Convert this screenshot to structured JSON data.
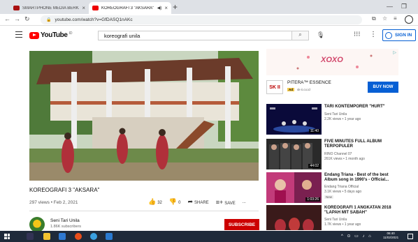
{
  "browser": {
    "tabs": [
      {
        "title": "SMARTPHONE MEDIA BERKARYA",
        "active": false,
        "favicon": "photo-favicon"
      },
      {
        "title": "KOREOGRAFI 3 \"AKSARA\"",
        "active": true,
        "favicon": "youtube-favicon"
      }
    ],
    "url": "youtube.com/watch?v=GfDASQ1nAKc"
  },
  "youtube": {
    "logo_text": "YouTube",
    "logo_country": "ID",
    "search_query": "koreografi unila",
    "signin_label": "SIGN IN"
  },
  "video": {
    "title": "KOREOGRAFI 3 \"AKSARA\"",
    "meta": "297 views • Feb 2, 2021",
    "likes": "32",
    "dislikes": "0",
    "share_label": "SHARE",
    "save_label": "SAVE",
    "more": "..."
  },
  "channel": {
    "name": "Seni Tari Unila",
    "subscribers": "1.86K subscribers",
    "subscribe_label": "SUBSCRIBE"
  },
  "ad": {
    "banner_text": "XOXO",
    "logo_text": "SK II",
    "title": "PITERA™ ESSENCE",
    "badge": "Ad",
    "domain": "sk-ii.co.id",
    "cta": "BUY NOW"
  },
  "related": [
    {
      "title": "TARI KONTEMPORER \"HURT\"",
      "channel": "Seni Tari Unila",
      "meta": "2.2K views • 1 year ago",
      "duration": "11:40",
      "badge": ""
    },
    {
      "title": "FIVE MINUTES FULL ALBUM TERPOPULER",
      "channel": "RINO Channel 07",
      "meta": "261K views • 1 month ago",
      "duration": "44:02",
      "badge": ""
    },
    {
      "title": "Endang Triana - Best of the best Album song in 1990's - Official...",
      "channel": "Endang Triana Official",
      "meta": "3.1K views • 5 days ago",
      "duration": "1:03:26",
      "badge": "New"
    },
    {
      "title": "KOREOGRAFI 1 ANGKATAN 2018 \"LAPAH MIT SABAH\"",
      "channel": "Seni Tari Unila",
      "meta": "1.7K views • 1 year ago",
      "duration": "",
      "badge": ""
    }
  ],
  "taskbar": {
    "time": "06:40",
    "date": "11/02/2021"
  }
}
